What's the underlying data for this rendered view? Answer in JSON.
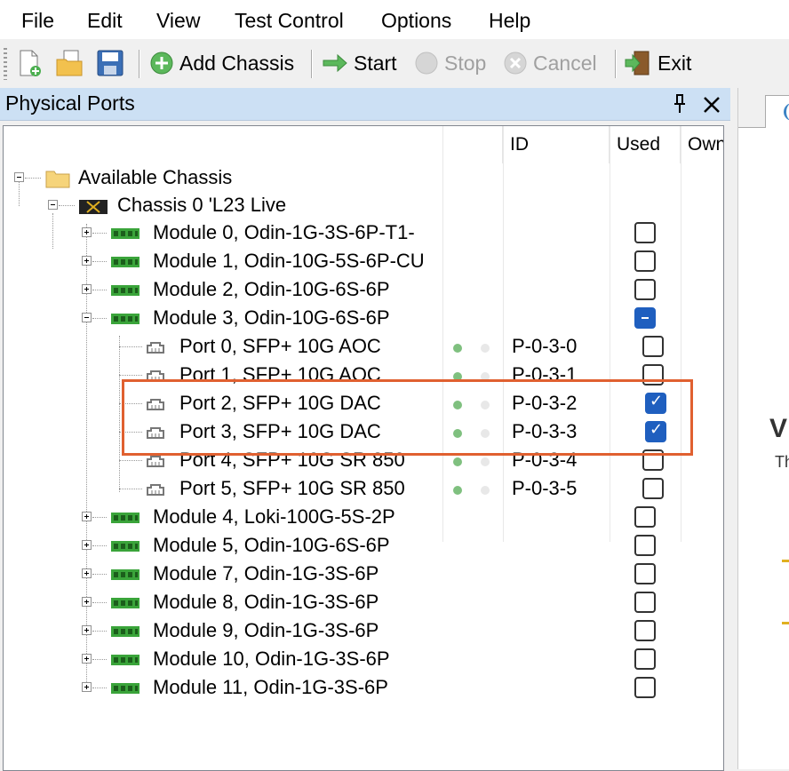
{
  "menu": [
    "File",
    "Edit",
    "View",
    "Test Control",
    "Options",
    "Help"
  ],
  "toolbar": {
    "add_chassis": "Add Chassis",
    "start": "Start",
    "stop": "Stop",
    "cancel": "Cancel",
    "exit": "Exit"
  },
  "panel": {
    "title": "Physical Ports",
    "pin_glyph": "📌",
    "close_glyph": "✕"
  },
  "columns": {
    "id": "ID",
    "used": "Used",
    "owner": "Own"
  },
  "tree": {
    "root": "Available Chassis",
    "chassis": "Chassis 0 'L23 Live",
    "modules_top": [
      {
        "label": "Module 0, Odin-1G-3S-6P-T1-",
        "used": "unchecked"
      },
      {
        "label": "Module 1, Odin-10G-5S-6P-CU",
        "used": "unchecked"
      },
      {
        "label": "Module 2, Odin-10G-6S-6P",
        "used": "unchecked"
      },
      {
        "label": "Module 3, Odin-10G-6S-6P",
        "used": "indeterminate"
      }
    ],
    "ports": [
      {
        "label": "Port 0, SFP+ 10G AOC",
        "id": "P-0-3-0",
        "used": "unchecked"
      },
      {
        "label": "Port 1, SFP+ 10G AOC",
        "id": "P-0-3-1",
        "used": "unchecked"
      },
      {
        "label": "Port 2, SFP+ 10G DAC",
        "id": "P-0-3-2",
        "used": "checked"
      },
      {
        "label": "Port 3, SFP+ 10G DAC",
        "id": "P-0-3-3",
        "used": "checked"
      },
      {
        "label": "Port 4, SFP+ 10G SR 850",
        "id": "P-0-3-4",
        "used": "unchecked"
      },
      {
        "label": "Port 5, SFP+ 10G SR 850",
        "id": "P-0-3-5",
        "used": "unchecked"
      }
    ],
    "modules_bottom": [
      {
        "label": "Module 4, Loki-100G-5S-2P",
        "used": "unchecked"
      },
      {
        "label": "Module 5, Odin-10G-6S-6P",
        "used": "unchecked"
      },
      {
        "label": "Module 7, Odin-1G-3S-6P",
        "used": "unchecked"
      },
      {
        "label": "Module 8, Odin-1G-3S-6P",
        "used": "unchecked"
      },
      {
        "label": "Module 9, Odin-1G-3S-6P",
        "used": "unchecked"
      },
      {
        "label": "Module 10, Odin-1G-3S-6P",
        "used": "unchecked"
      },
      {
        "label": "Module 11, Odin-1G-3S-6P",
        "used": "unchecked"
      }
    ]
  },
  "right_panel": {
    "large_text": "V",
    "small_text": "Th"
  },
  "colors": {
    "highlight": "#e06030",
    "header_bg": "#cce0f4",
    "checked": "#1f5fbf",
    "led_green": "#7fc07f"
  }
}
